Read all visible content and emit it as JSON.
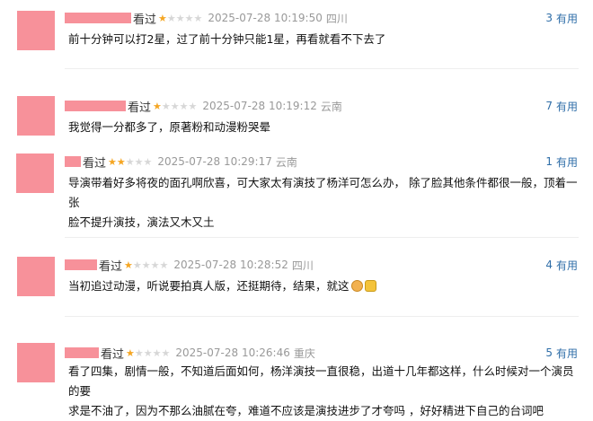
{
  "reviews": [
    {
      "watched": "看过",
      "stars": 1,
      "time": "2025-07-28 10:19:50",
      "location": "四川",
      "useful_count": "3",
      "useful_label": "有用",
      "text": "前十分钟可以打2星，过了前十分钟只能1星，再看就看不下去了"
    },
    {
      "watched": "看过",
      "stars": 1,
      "time": "2025-07-28 10:19:12",
      "location": "云南",
      "useful_count": "7",
      "useful_label": "有用",
      "text": "我觉得一分都多了，原著粉和动漫粉哭晕"
    },
    {
      "watched": "看过",
      "stars": 2,
      "time": "2025-07-28 10:29:17",
      "location": "云南",
      "useful_count": "1",
      "useful_label": "有用",
      "text_line1": "导演带着好多将夜的面孔啊欣喜，可大家太有演技了杨洋可怎么办， 除了脸其他条件都很一般，顶着一张",
      "text_line2": "脸不提升演技，演法又木又土"
    },
    {
      "watched": "看过",
      "stars": 1,
      "time": "2025-07-28 10:28:52",
      "location": "四川",
      "useful_count": "4",
      "useful_label": "有用",
      "text": "当初追过动漫，听说要拍真人版，还挺期待，结果，就这",
      "emojis": [
        "cat-face-icon",
        "thumbs-down-icon"
      ]
    },
    {
      "watched": "看过",
      "stars": 1,
      "time": "2025-07-28 10:26:46",
      "location": "重庆",
      "useful_count": "5",
      "useful_label": "有用",
      "text_line1": "看了四集，剧情一般，不知道后面如何，杨洋演技一直很稳，出道十几年都这样，什么时候对一个演员的要",
      "text_line2": "求是不油了，因为不那么油腻在夸，难道不应该是演技进步了才夸吗 ，好好精进下自己的台词吧"
    }
  ],
  "colors": {
    "accent_link": "#2f6ea8",
    "star_on": "#f5a623",
    "star_off": "#d7d7d7",
    "redaction": "#f7919a",
    "meta_gray": "#999999"
  }
}
